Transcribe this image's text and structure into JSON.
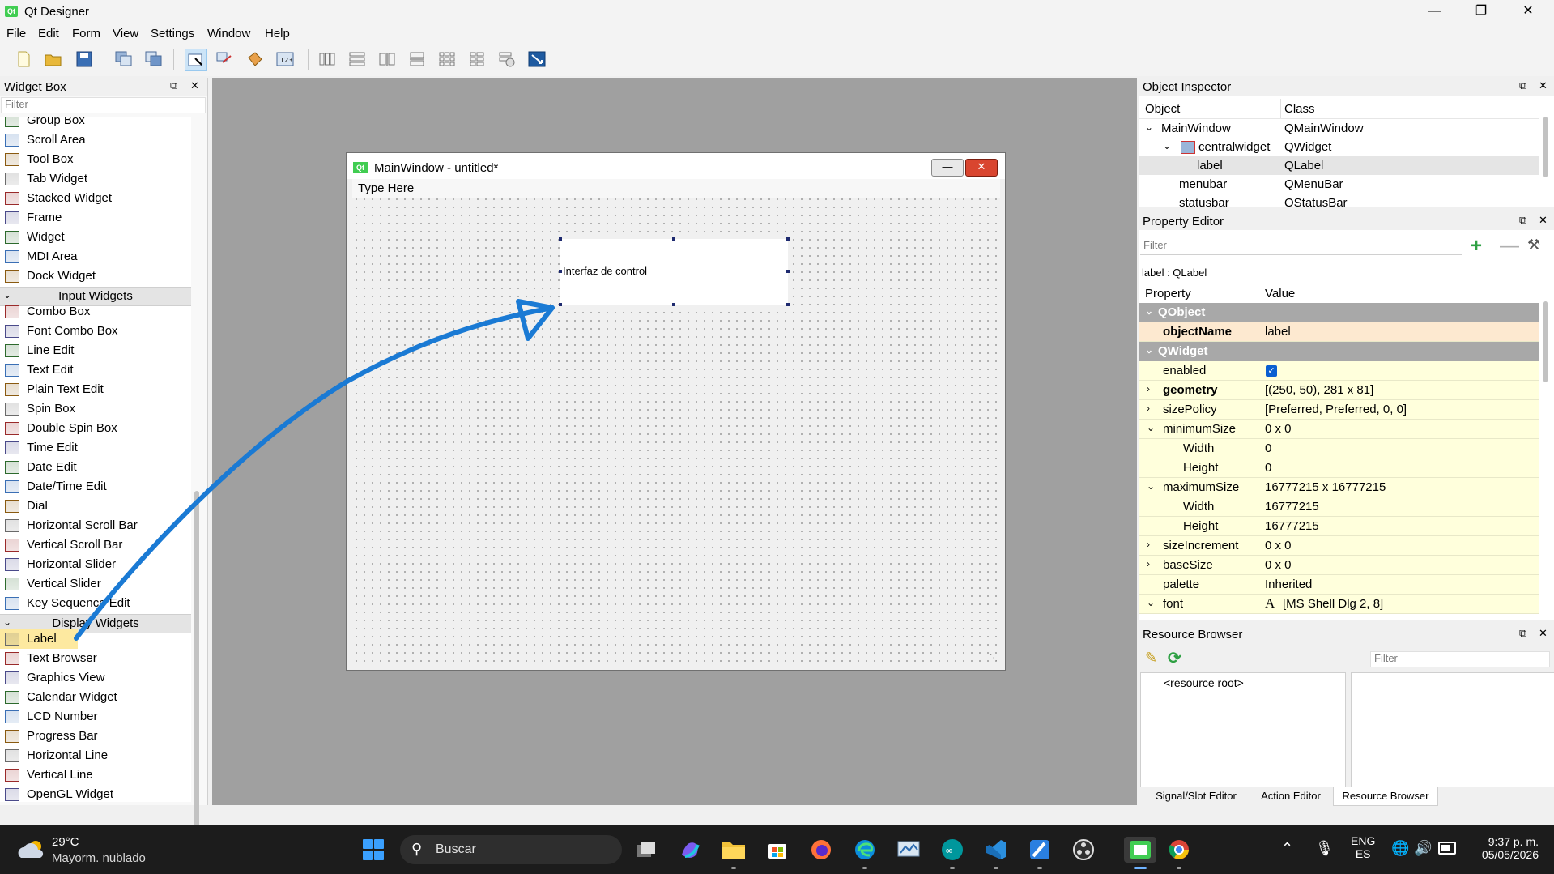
{
  "window": {
    "title": "Qt Designer",
    "app_icon": "Qt"
  },
  "menubar": [
    "File",
    "Edit",
    "Form",
    "View",
    "Settings",
    "Window",
    "Help"
  ],
  "widget_box": {
    "title": "Widget Box",
    "filter_placeholder": "Filter",
    "items": [
      {
        "type": "item",
        "label": "Group Box"
      },
      {
        "type": "item",
        "label": "Scroll Area"
      },
      {
        "type": "item",
        "label": "Tool Box"
      },
      {
        "type": "item",
        "label": "Tab Widget"
      },
      {
        "type": "item",
        "label": "Stacked Widget"
      },
      {
        "type": "item",
        "label": "Frame"
      },
      {
        "type": "item",
        "label": "Widget"
      },
      {
        "type": "item",
        "label": "MDI Area"
      },
      {
        "type": "item",
        "label": "Dock Widget"
      },
      {
        "type": "cat",
        "label": "Input Widgets"
      },
      {
        "type": "item",
        "label": "Combo Box"
      },
      {
        "type": "item",
        "label": "Font Combo Box"
      },
      {
        "type": "item",
        "label": "Line Edit"
      },
      {
        "type": "item",
        "label": "Text Edit"
      },
      {
        "type": "item",
        "label": "Plain Text Edit"
      },
      {
        "type": "item",
        "label": "Spin Box"
      },
      {
        "type": "item",
        "label": "Double Spin Box"
      },
      {
        "type": "item",
        "label": "Time Edit"
      },
      {
        "type": "item",
        "label": "Date Edit"
      },
      {
        "type": "item",
        "label": "Date/Time Edit"
      },
      {
        "type": "item",
        "label": "Dial"
      },
      {
        "type": "item",
        "label": "Horizontal Scroll Bar"
      },
      {
        "type": "item",
        "label": "Vertical Scroll Bar"
      },
      {
        "type": "item",
        "label": "Horizontal Slider"
      },
      {
        "type": "item",
        "label": "Vertical Slider"
      },
      {
        "type": "item",
        "label": "Key Sequence Edit"
      },
      {
        "type": "cat",
        "label": "Display Widgets"
      },
      {
        "type": "item",
        "label": "Label",
        "selected": true
      },
      {
        "type": "item",
        "label": "Text Browser"
      },
      {
        "type": "item",
        "label": "Graphics View"
      },
      {
        "type": "item",
        "label": "Calendar Widget"
      },
      {
        "type": "item",
        "label": "LCD Number"
      },
      {
        "type": "item",
        "label": "Progress Bar"
      },
      {
        "type": "item",
        "label": "Horizontal Line"
      },
      {
        "type": "item",
        "label": "Vertical Line"
      },
      {
        "type": "item",
        "label": "OpenGL Widget"
      }
    ]
  },
  "form": {
    "title": "MainWindow - untitled*",
    "menu_placeholder": "Type Here",
    "label_text": "Interfaz de control"
  },
  "object_inspector": {
    "title": "Object Inspector",
    "headers": [
      "Object",
      "Class"
    ],
    "rows": [
      {
        "object": "MainWindow",
        "class": "QMainWindow",
        "indent": 0,
        "expander": "v"
      },
      {
        "object": "centralwidget",
        "class": "QWidget",
        "indent": 1,
        "expander": "v"
      },
      {
        "object": "label",
        "class": "QLabel",
        "indent": 2,
        "selected": true
      },
      {
        "object": "menubar",
        "class": "QMenuBar",
        "indent": 1
      },
      {
        "object": "statusbar",
        "class": "QStatusBar",
        "indent": 1
      }
    ]
  },
  "property_editor": {
    "title": "Property Editor",
    "filter_placeholder": "Filter",
    "context": "label : QLabel",
    "headers": [
      "Property",
      "Value"
    ],
    "rows": [
      {
        "kind": "group",
        "name": "QObject"
      },
      {
        "kind": "prop",
        "name": "objectName",
        "value": "label",
        "bold": true,
        "highlight": true
      },
      {
        "kind": "group",
        "name": "QWidget"
      },
      {
        "kind": "prop",
        "name": "enabled",
        "value": "",
        "checkbox": true
      },
      {
        "kind": "prop",
        "name": "geometry",
        "value": "[(250, 50), 281 x 81]",
        "bold": true,
        "exp": ">"
      },
      {
        "kind": "prop",
        "name": "sizePolicy",
        "value": "[Preferred, Preferred, 0, 0]",
        "exp": ">"
      },
      {
        "kind": "prop",
        "name": "minimumSize",
        "value": "0 x 0",
        "exp": "v"
      },
      {
        "kind": "sub",
        "name": "Width",
        "value": "0"
      },
      {
        "kind": "sub",
        "name": "Height",
        "value": "0"
      },
      {
        "kind": "prop",
        "name": "maximumSize",
        "value": "16777215 x 16777215",
        "exp": "v"
      },
      {
        "kind": "sub",
        "name": "Width",
        "value": "16777215"
      },
      {
        "kind": "sub",
        "name": "Height",
        "value": "16777215"
      },
      {
        "kind": "prop",
        "name": "sizeIncrement",
        "value": "0 x 0",
        "exp": ">"
      },
      {
        "kind": "prop",
        "name": "baseSize",
        "value": "0 x 0",
        "exp": ">"
      },
      {
        "kind": "prop",
        "name": "palette",
        "value": "Inherited"
      },
      {
        "kind": "prop",
        "name": "font",
        "value": "[MS Shell Dlg 2, 8]",
        "exp": "v",
        "fonticon": "A"
      }
    ]
  },
  "resource_browser": {
    "title": "Resource Browser",
    "filter_placeholder": "Filter",
    "root": "<resource root>",
    "tabs": [
      "Signal/Slot Editor",
      "Action Editor",
      "Resource Browser"
    ]
  },
  "taskbar": {
    "weather_temp": "29°C",
    "weather_desc": "Mayorm. nublado",
    "search": "Buscar",
    "lang1": "ENG",
    "lang2": "ES",
    "time": "9:37 p. m.",
    "date": "05/05/2026"
  },
  "colors": {
    "accent": "#0a5fd1",
    "annotation_arrow": "#1a7ad4",
    "qt_green": "#41cd52",
    "selection_yellow": "#fde9a0"
  }
}
